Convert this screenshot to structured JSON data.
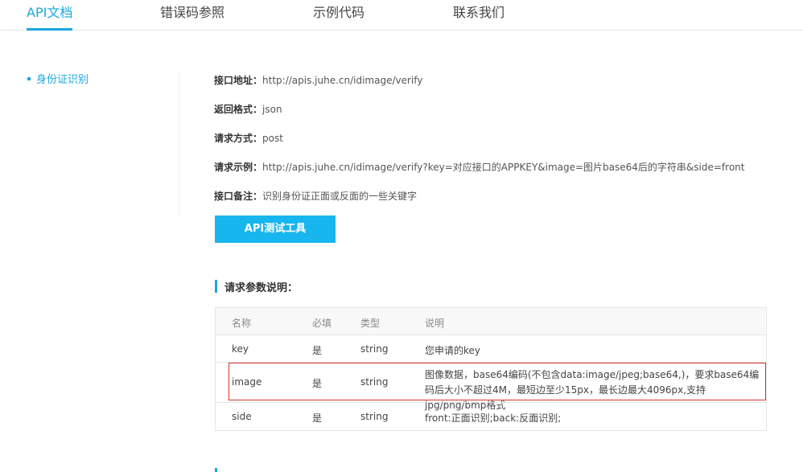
{
  "tabs": [
    {
      "label": "API文档",
      "active": true
    },
    {
      "label": "错误码参照",
      "active": false
    },
    {
      "label": "示例代码",
      "active": false
    },
    {
      "label": "联系我们",
      "active": false
    }
  ],
  "sidebar": {
    "items": [
      {
        "label": "身份证识别"
      }
    ]
  },
  "info": {
    "address": {
      "key": "接口地址：",
      "value": "http://apis.juhe.cn/idimage/verify"
    },
    "format": {
      "key": "返回格式：",
      "value": "json"
    },
    "method": {
      "key": "请求方式：",
      "value": "post"
    },
    "example": {
      "key": "请求示例：",
      "value": "http://apis.juhe.cn/idimage/verify?key=对应接口的APPKEY&image=图片base64后的字符串&side=front"
    },
    "note": {
      "key": "接口备注：",
      "value": "识别身份证正面或反面的一些关键字"
    }
  },
  "button": {
    "label": "API测试工具"
  },
  "params_section": {
    "title": "请求参数说明："
  },
  "params_table": {
    "headers": [
      "名称",
      "必填",
      "类型",
      "说明"
    ],
    "rows": [
      [
        "key",
        "是",
        "string",
        "您申请的key"
      ],
      [
        "image",
        "是",
        "string",
        "图像数据，base64编码(不包含data:image/jpeg;base64,)，要求base64编码后大小不超过4M，最短边至少15px，最长边最大4096px,支持jpg/png/bmp格式"
      ],
      [
        "side",
        "是",
        "string",
        "front:正面识别;back:反面识别;"
      ]
    ]
  },
  "colors": {
    "accent": "#1aa7e0",
    "button": "#18b6ee",
    "highlight": "#d9322e"
  }
}
